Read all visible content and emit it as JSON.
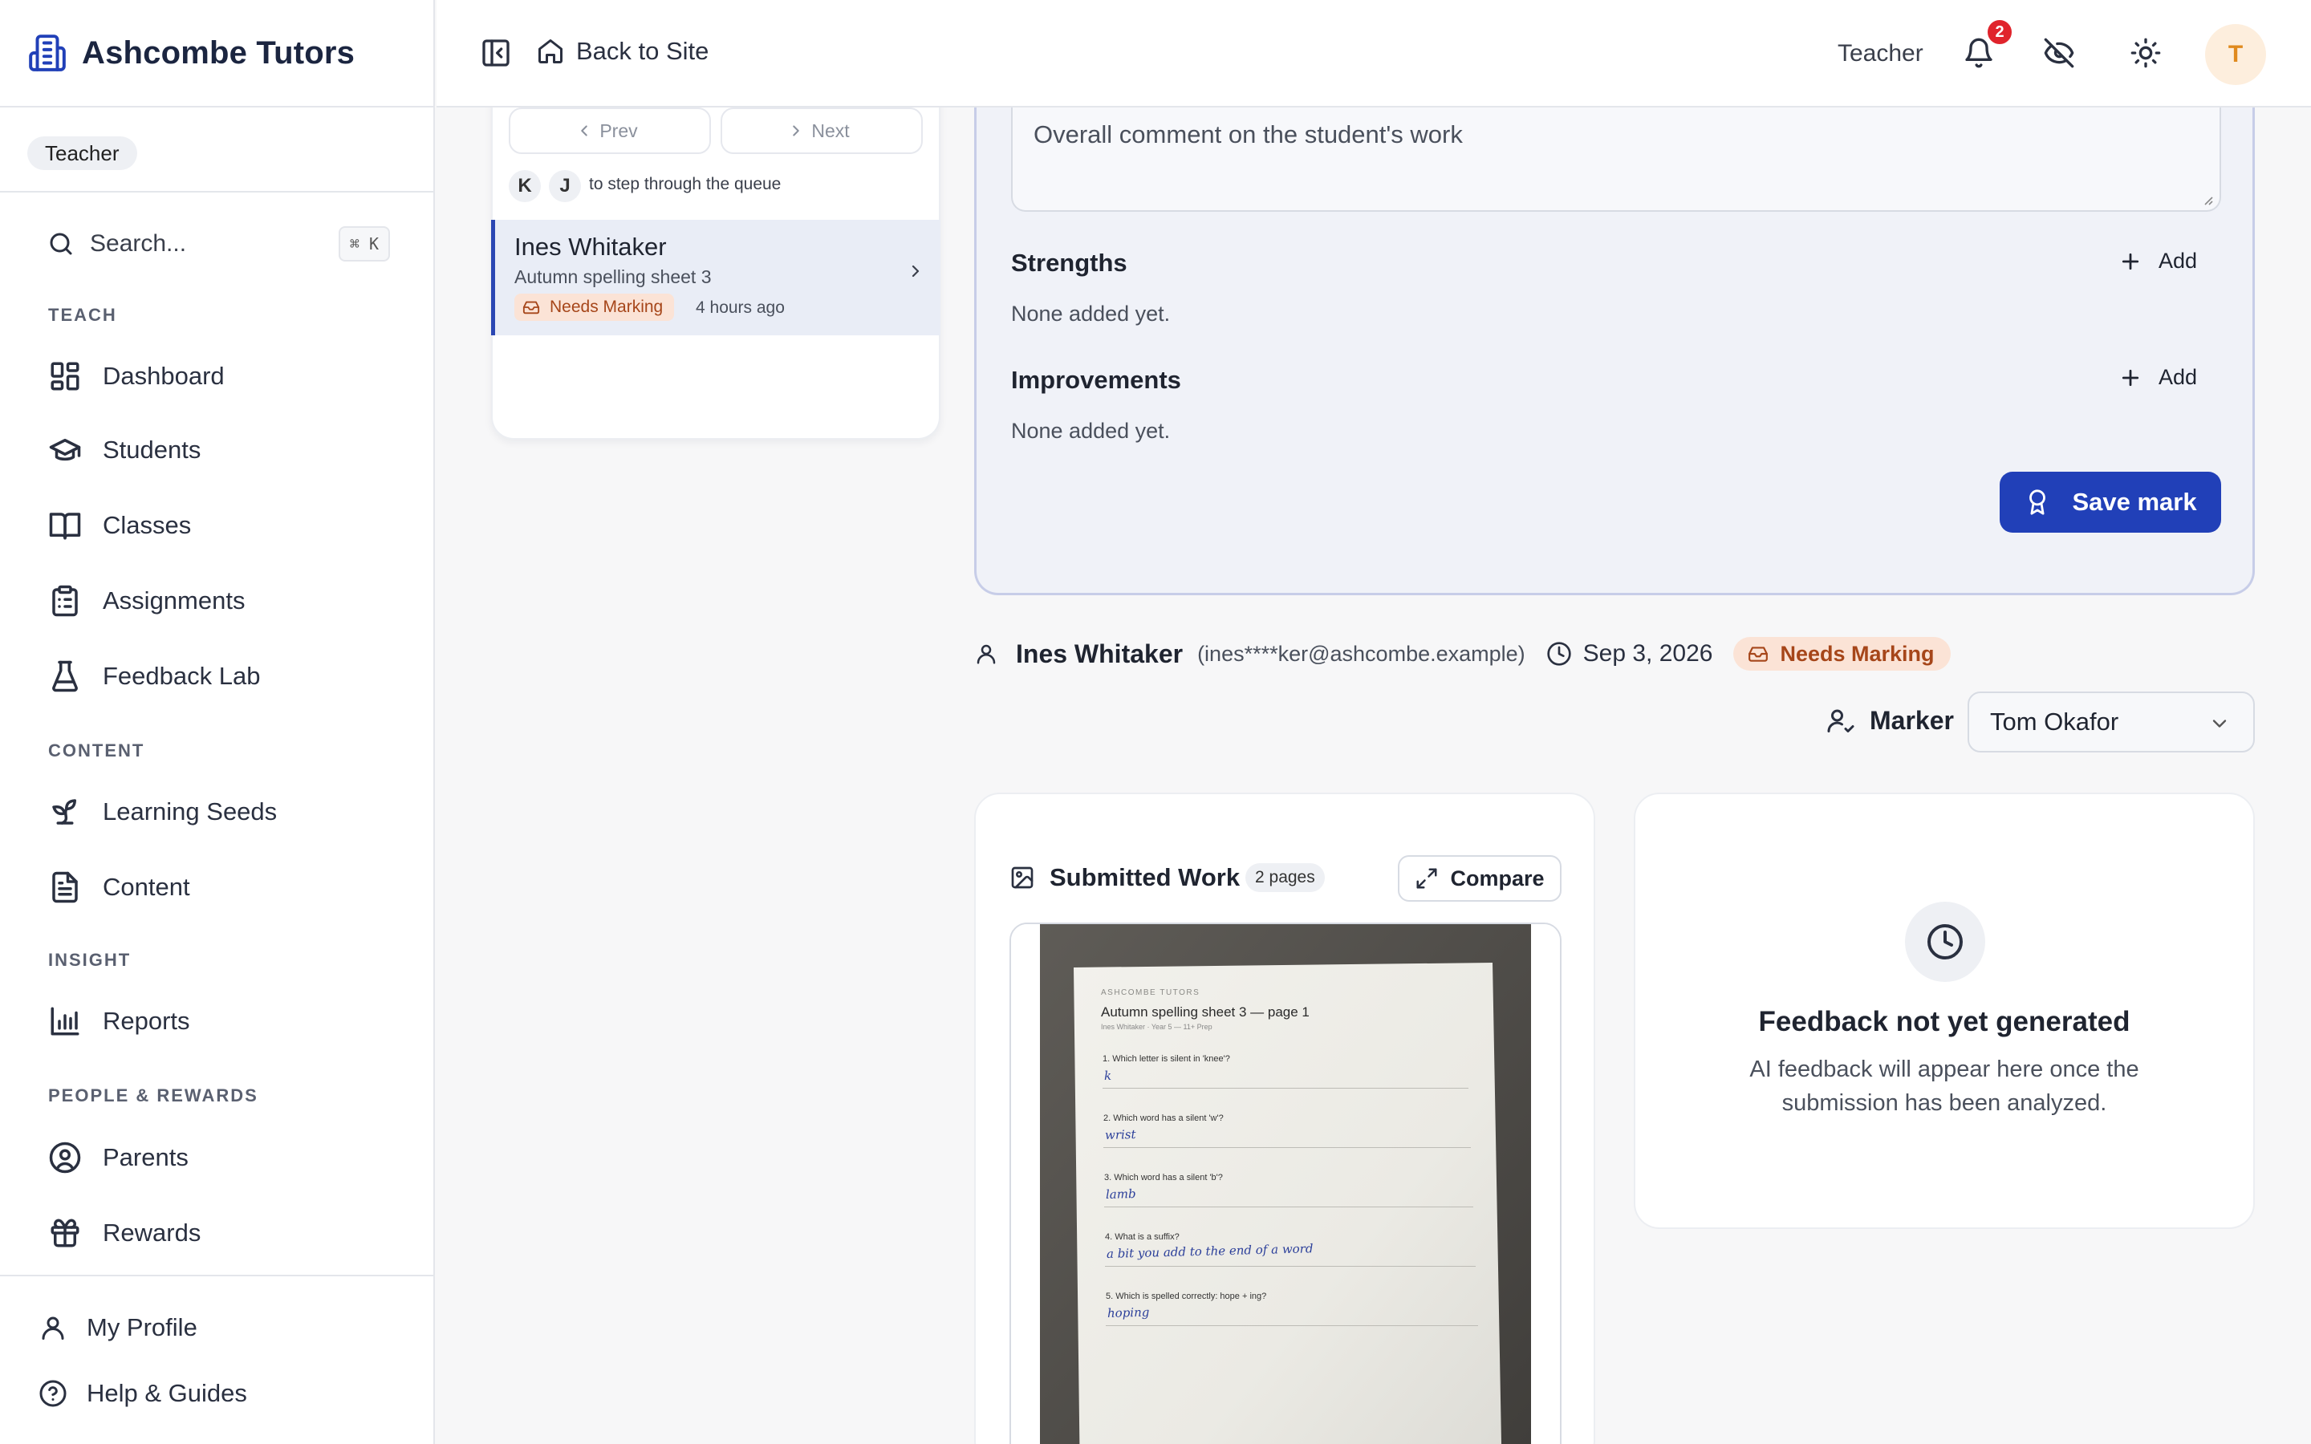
{
  "app": {
    "name": "Ashcombe Tutors",
    "role_chip": "Teacher"
  },
  "sidebar": {
    "search_placeholder": "Search...",
    "search_shortcut": "⌘ K",
    "sections": {
      "teach": "TEACH",
      "content": "CONTENT",
      "insight": "INSIGHT",
      "people": "PEOPLE & REWARDS"
    },
    "items": {
      "dashboard": "Dashboard",
      "students": "Students",
      "classes": "Classes",
      "assignments": "Assignments",
      "feedback_lab": "Feedback Lab",
      "learning_seeds": "Learning Seeds",
      "content": "Content",
      "reports": "Reports",
      "parents": "Parents",
      "rewards": "Rewards"
    },
    "footer": {
      "profile": "My Profile",
      "help": "Help & Guides"
    }
  },
  "topbar": {
    "back_label": "Back to Site",
    "role": "Teacher",
    "notification_count": "2",
    "avatar_initial": "T"
  },
  "queue": {
    "prev_label": "Prev",
    "next_label": "Next",
    "key1": "K",
    "key2": "J",
    "key_hint": "to step through the queue",
    "item": {
      "student": "Ines Whitaker",
      "assignment": "Autumn spelling sheet 3",
      "status": "Needs Marking",
      "time": "4 hours ago"
    }
  },
  "form": {
    "comment_placeholder": "Overall comment on the student's work",
    "strengths_label": "Strengths",
    "strengths_empty": "None added yet.",
    "improvements_label": "Improvements",
    "improvements_empty": "None added yet.",
    "add_label": "Add",
    "save_label": "Save mark"
  },
  "submission": {
    "student": "Ines Whitaker",
    "email": "(ines****ker@ashcombe.example)",
    "date": "Sep 3, 2026",
    "status": "Needs Marking",
    "marker_label": "Marker",
    "marker_value": "Tom Okafor"
  },
  "work": {
    "title": "Submitted Work",
    "pages": "2 pages",
    "compare_label": "Compare",
    "sheet": {
      "brand": "ASHCOMBE TUTORS",
      "title": "Autumn spelling sheet 3 — page 1",
      "meta": "Ines Whitaker · Year 5 — 11+ Prep",
      "questions": [
        {
          "q": "1. Which letter is silent in 'knee'?",
          "a": "k"
        },
        {
          "q": "2. Which word has a silent 'w'?",
          "a": "wrist"
        },
        {
          "q": "3. Which word has a silent 'b'?",
          "a": "lamb"
        },
        {
          "q": "4. What is a suffix?",
          "a": "a bit you add to the end of a word"
        },
        {
          "q": "5. Which is spelled correctly: hope + ing?",
          "a": "hoping"
        }
      ]
    }
  },
  "feedback": {
    "title": "Feedback not yet generated",
    "description": "AI feedback will appear here once the submission has been analyzed."
  },
  "colors": {
    "accent": "#2140b8",
    "status_bg": "#fbe3d6",
    "status_text": "#a6461a",
    "notification": "#e0242c"
  }
}
